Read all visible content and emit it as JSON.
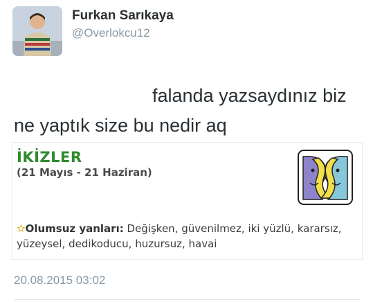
{
  "tweet": {
    "author_name": "Furkan Sarıkaya",
    "author_handle": "@Overlokcu12",
    "text_line1": "falanda yazsaydınız biz",
    "text_line2": "ne yaptık size bu nedir aq",
    "timestamp": "20.08.2015 03:02"
  },
  "embed": {
    "sign_title": "İKİZLER",
    "sign_dates": "(21 Mayıs - 21 Haziran)",
    "traits_label": "Olumsuz yanları:",
    "traits_text": "Değişken, güvenilmez, iki yüzlü, kararsız, yüzeysel, dedikoducu, huzursuz, havai",
    "star_glyph": "✫",
    "icon": "gemini-twins-icon"
  },
  "colors": {
    "sign_title": "#2e8b2e",
    "text": "#292f33",
    "muted": "#8899a6",
    "star": "#d9a400"
  }
}
